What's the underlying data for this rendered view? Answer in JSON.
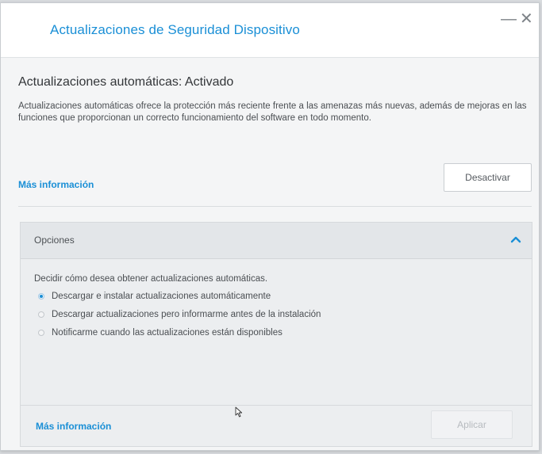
{
  "window": {
    "title": "Actualizaciones de Seguridad Dispositivo",
    "minimize_glyph": "—",
    "close_glyph": "✕"
  },
  "auto_updates": {
    "heading": "Actualizaciones automáticas: Activado",
    "description": "Actualizaciones automáticas ofrece la protección más reciente frente a las amenazas más nuevas, además de mejoras en las funciones que proporcionan un correcto funcionamiento del software en todo momento.",
    "more_info_link": "Más información",
    "deactivate_button": "Desactivar"
  },
  "options": {
    "header_label": "Opciones",
    "chevron_icon": "chevron-up-icon",
    "prompt": "Decidir cómo desea obtener actualizaciones automáticas.",
    "choices": [
      {
        "label": "Descargar e instalar actualizaciones automáticamente",
        "selected": true
      },
      {
        "label": "Descargar actualizaciones pero informarme antes de la instalación",
        "selected": false
      },
      {
        "label": "Notificarme cuando las actualizaciones están disponibles",
        "selected": false
      }
    ],
    "more_info_link": "Más información",
    "apply_button": "Aplicar"
  },
  "colors": {
    "accent": "#1a8fd6",
    "window_bg": "#f4f5f6",
    "panel_bg": "#eceef0"
  }
}
